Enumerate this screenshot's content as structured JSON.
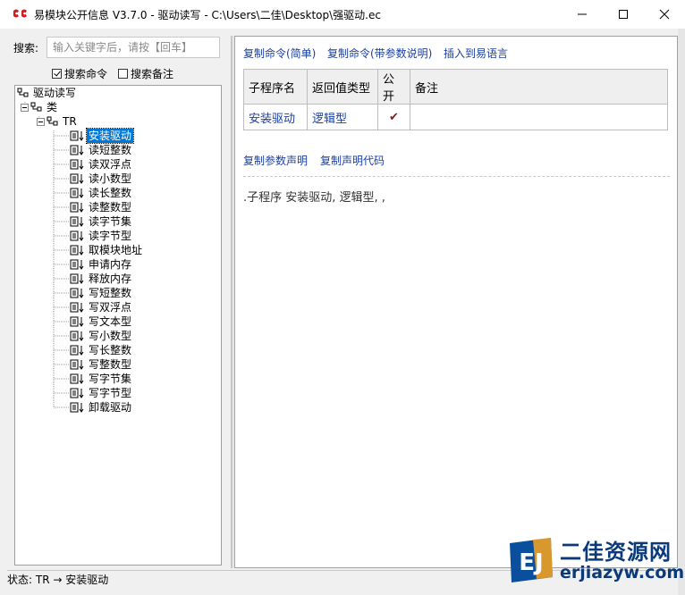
{
  "window": {
    "title": "易模块公开信息 V3.7.0 - 驱动读写 - C:\\Users\\二佳\\Desktop\\强驱动.ec",
    "controls": [
      "minimize-icon",
      "maximize-icon",
      "close-icon"
    ]
  },
  "search": {
    "label": "搜索:",
    "placeholder": "输入关键字后，请按【回车】",
    "value": "",
    "options": [
      {
        "label": "搜索命令",
        "checked": true
      },
      {
        "label": "搜索备注",
        "checked": false
      }
    ]
  },
  "tree": {
    "root": "驱动读写",
    "class_node": "类",
    "class_name": "TR",
    "selected": "安装驱动",
    "methods": [
      "安装驱动",
      "读短整数",
      "读双浮点",
      "读小数型",
      "读长整数",
      "读整数型",
      "读字节集",
      "读字节型",
      "取模块地址",
      "申请内存",
      "释放内存",
      "写短整数",
      "写双浮点",
      "写文本型",
      "写小数型",
      "写长整数",
      "写整数型",
      "写字节集",
      "写字节型",
      "卸载驱动"
    ]
  },
  "detail": {
    "links_top": [
      "复制命令(简单)",
      "复制命令(带参数说明)",
      "插入到易语言"
    ],
    "table": {
      "headers": [
        "子程序名",
        "返回值类型",
        "公开",
        "备注"
      ],
      "row": {
        "name": "安装驱动",
        "return_type": "逻辑型",
        "public": "✔",
        "note": ""
      }
    },
    "links_mid": [
      "复制参数声明",
      "复制声明代码"
    ],
    "declaration": ".子程序 安装驱动, 逻辑型, ,"
  },
  "status": {
    "text": "状态:  TR → 安装驱动"
  },
  "watermark": {
    "logo_text": "EJ",
    "title": "二佳资源网",
    "url": "erjiazyw.com"
  },
  "colors": {
    "link": "#1a3fa0",
    "selection": "#0078d7",
    "check": "#8b1a1a"
  }
}
